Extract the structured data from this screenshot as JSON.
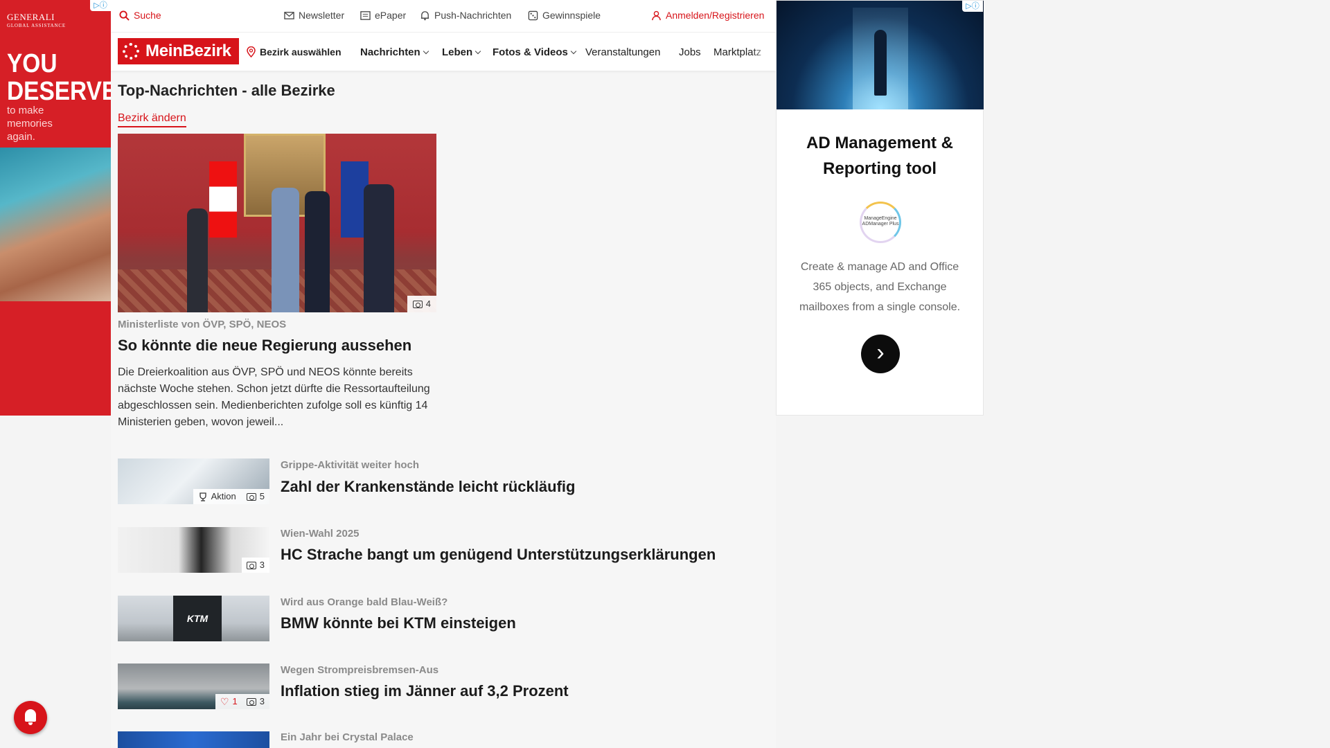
{
  "ad_left": {
    "brand": "GENERALI",
    "brand_sub": "GLOBAL ASSISTANCE",
    "headline": "YOU DESERVE",
    "subline": "to make memories again."
  },
  "ad_right": {
    "title": "AD Management & Reporting tool",
    "logo_text": "ManageEngine ADManager Plus",
    "body": "Create & manage AD and Office 365 objects, and Exchange mailboxes from a single console.",
    "cta_icon": "chevron-right-icon"
  },
  "topbar": {
    "search": "Suche",
    "newsletter": "Newsletter",
    "epaper": "ePaper",
    "push": "Push-Nachrichten",
    "gewinnspiele": "Gewinnspiele",
    "login": "Anmelden/Registrieren"
  },
  "nav": {
    "logo": "MeinBezirk",
    "bezirk": "Bezirk auswählen",
    "items": [
      "Nachrichten",
      "Leben",
      "Fotos & Videos",
      "Veranstaltungen",
      "Jobs",
      "Marktplatz"
    ]
  },
  "section": {
    "title": "Top-Nachrichten - alle Bezirke",
    "change_link": "Bezirk ändern"
  },
  "hero": {
    "kicker": "Ministerliste von ÖVP, SPÖ, NEOS",
    "headline": "So könnte die neue Regierung aussehen",
    "teaser": "Die Dreierkoalition aus ÖVP, SPÖ und NEOS könnte bereits nächste Woche stehen. Schon jetzt dürfte die Ressortaufteilung abgeschlossen sein. Medienberichten zufolge soll es künftig 14 Ministerien geben, wovon jeweil...",
    "photo_count": "4"
  },
  "articles": [
    {
      "kicker": "Grippe-Aktivität weiter hoch",
      "headline": "Zahl der Krankenstände leicht rückläufig",
      "action": "Aktion",
      "photo_count": "5"
    },
    {
      "kicker": "Wien-Wahl 2025",
      "headline": "HC Strache bangt um genügend Unterstützungserklärungen",
      "photo_count": "3"
    },
    {
      "kicker": "Wird aus Orange bald Blau-Weiß?",
      "headline": "BMW könnte bei KTM einsteigen",
      "thumb_text": "KTM"
    },
    {
      "kicker": "Wegen Strompreisbremsen-Aus",
      "headline": "Inflation stieg im Jänner auf 3,2 Prozent",
      "likes": "1",
      "photo_count": "3"
    },
    {
      "kicker": "Ein Jahr bei Crystal Palace",
      "headline": ""
    }
  ]
}
